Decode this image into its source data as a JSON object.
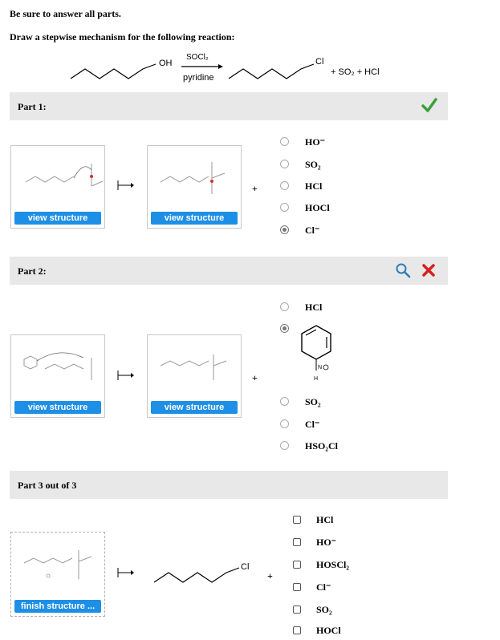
{
  "header": {
    "instruction": "Be sure to answer all parts.",
    "prompt": "Draw a stepwise mechanism for the following reaction:"
  },
  "reaction": {
    "reactant_label": "OH",
    "reagent": "SOCl₂",
    "condition": "pyridine",
    "product_label": "Cl",
    "byproducts": "+ SO₂ + HCl"
  },
  "part1": {
    "title": "Part 1:",
    "status_icon": "checkmark-icon",
    "box1_button": "view structure",
    "box2_button": "view structure",
    "plus": "+",
    "options": [
      {
        "label": "HO⁻",
        "selected": false
      },
      {
        "label": "SO₂",
        "selected": false
      },
      {
        "label": "HCl",
        "selected": false
      },
      {
        "label": "HOCl",
        "selected": false
      },
      {
        "label": "Cl⁻",
        "selected": true
      }
    ]
  },
  "part2": {
    "title": "Part 2:",
    "status_icons": [
      "magnifier-icon",
      "x-mark-icon"
    ],
    "box1_button": "view structure",
    "box2_button": "view structure",
    "plus": "+",
    "pyridinium_H": "H",
    "pyridinium_N": "N",
    "options": [
      {
        "label": "HCl",
        "selected": false
      },
      {
        "label": "pyridinium",
        "selected": true
      },
      {
        "label": "SO₂",
        "selected": false
      },
      {
        "label": "Cl⁻",
        "selected": false
      },
      {
        "label": "HSO₂Cl",
        "selected": false
      }
    ]
  },
  "part3": {
    "title": "Part 3 out of 3",
    "box1_button": "finish structure ...",
    "product_label": "Cl",
    "plus": "+",
    "options": [
      {
        "label": "HCl",
        "checked": false
      },
      {
        "label": "HO⁻",
        "checked": false
      },
      {
        "label": "HOSCl₂",
        "checked": false
      },
      {
        "label": "Cl⁻",
        "checked": false
      },
      {
        "label": "SO₂",
        "checked": false
      },
      {
        "label": "HOCl",
        "checked": false
      }
    ]
  },
  "colors": {
    "accent": "#1e8fe6",
    "check": "#3aa03a",
    "error": "#d62020",
    "bar": "#e8e8e8"
  }
}
